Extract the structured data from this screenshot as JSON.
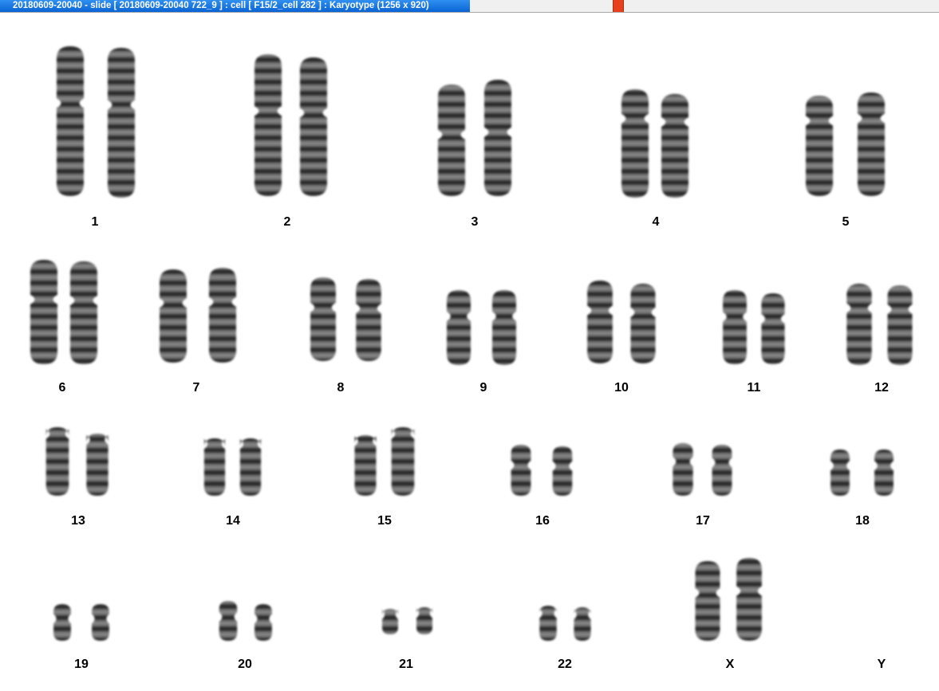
{
  "window": {
    "title": "20180609-20040 - slide [ 20180609-20040 722_9 ] : cell [ F15/2_cell 282 ] : Karyotype  (1256 x 920)",
    "title_bar_color": "#0a64d4",
    "marker_color": "#e8401c"
  },
  "karyotype": {
    "chromosomes": [
      {
        "label": "1",
        "count": 2
      },
      {
        "label": "2",
        "count": 2
      },
      {
        "label": "3",
        "count": 2
      },
      {
        "label": "4",
        "count": 2
      },
      {
        "label": "5",
        "count": 2
      },
      {
        "label": "6",
        "count": 2
      },
      {
        "label": "7",
        "count": 2
      },
      {
        "label": "8",
        "count": 2
      },
      {
        "label": "9",
        "count": 2
      },
      {
        "label": "10",
        "count": 2
      },
      {
        "label": "11",
        "count": 2
      },
      {
        "label": "12",
        "count": 2
      },
      {
        "label": "13",
        "count": 2
      },
      {
        "label": "14",
        "count": 2
      },
      {
        "label": "15",
        "count": 2
      },
      {
        "label": "16",
        "count": 2
      },
      {
        "label": "17",
        "count": 2
      },
      {
        "label": "18",
        "count": 2
      },
      {
        "label": "19",
        "count": 2
      },
      {
        "label": "20",
        "count": 2
      },
      {
        "label": "21",
        "count": 2
      },
      {
        "label": "22",
        "count": 2
      },
      {
        "label": "X",
        "count": 2
      },
      {
        "label": "Y",
        "count": 0
      }
    ]
  }
}
